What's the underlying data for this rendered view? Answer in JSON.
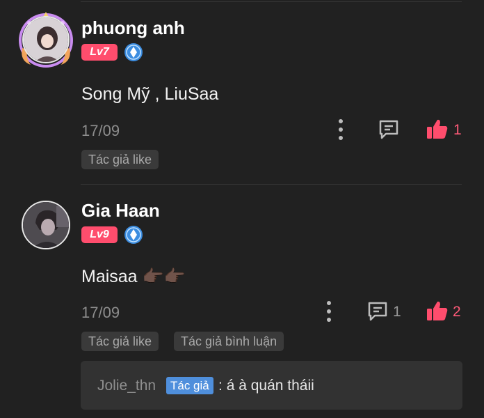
{
  "colors": {
    "background": "#212121",
    "accent_red": "#ff4d6d",
    "author_chip": "#4f8fdc",
    "tag_bg": "#3a3a3a"
  },
  "comments": [
    {
      "name": "phuong anh",
      "level": "Lv7",
      "content": "Song Mỹ , LiuSaa",
      "date": "17/09",
      "reply_count": "",
      "like_count": "1",
      "tags": [
        "Tác giả like"
      ]
    },
    {
      "name": "Gia Haan",
      "level": "Lv9",
      "content": "Maisaa 👉🏿👉🏿",
      "date": "17/09",
      "reply_count": "1",
      "like_count": "2",
      "tags": [
        "Tác giả like",
        "Tác giả bình luận"
      ],
      "reply": {
        "user": "Jolie_thn",
        "badge": "Tác giả",
        "separator": ":",
        "text": "á à quán tháii"
      }
    }
  ],
  "icons": {
    "more": "more-vertical-icon",
    "comment": "comment-icon",
    "like": "thumbs-up-icon",
    "verified": "verified-badge-icon"
  }
}
